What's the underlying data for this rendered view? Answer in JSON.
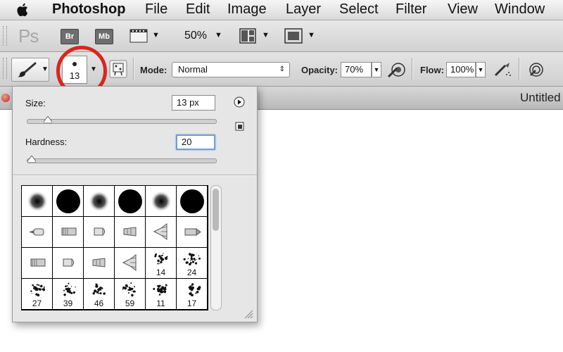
{
  "menubar": {
    "app_name": "Photoshop",
    "items": [
      "File",
      "Edit",
      "Image",
      "Layer",
      "Select",
      "Filter",
      "View",
      "Window"
    ]
  },
  "appbar": {
    "ps_logo": "Ps",
    "bridge_label": "Br",
    "minibridge_label": "Mb",
    "zoom_label": "50%"
  },
  "options": {
    "brush_size_value": "13",
    "mode_label": "Mode:",
    "mode_value": "Normal",
    "opacity_label": "Opacity:",
    "opacity_value": "70%",
    "flow_label": "Flow:",
    "flow_value": "100%"
  },
  "document": {
    "title": "Untitled"
  },
  "brush_panel": {
    "size_label": "Size:",
    "size_value": "13 px",
    "size_fraction": 0.09,
    "hardness_label": "Hardness:",
    "hardness_value": "20",
    "hardness_fraction": 0.0,
    "presets": [
      {
        "kind": "soft",
        "label": ""
      },
      {
        "kind": "hard",
        "label": ""
      },
      {
        "kind": "soft",
        "label": ""
      },
      {
        "kind": "hard",
        "label": ""
      },
      {
        "kind": "soft",
        "label": ""
      },
      {
        "kind": "hard",
        "label": ""
      },
      {
        "kind": "tip-round",
        "label": ""
      },
      {
        "kind": "tip-flat",
        "label": ""
      },
      {
        "kind": "tip-blunt",
        "label": ""
      },
      {
        "kind": "tip-angled",
        "label": ""
      },
      {
        "kind": "tip-fan",
        "label": ""
      },
      {
        "kind": "tip-point",
        "label": ""
      },
      {
        "kind": "tip-flat",
        "label": ""
      },
      {
        "kind": "tip-blunt",
        "label": ""
      },
      {
        "kind": "tip-angled",
        "label": ""
      },
      {
        "kind": "tip-fan",
        "label": ""
      },
      {
        "kind": "scatter",
        "label": "14"
      },
      {
        "kind": "scatter",
        "label": "24"
      },
      {
        "kind": "scatter",
        "label": "27"
      },
      {
        "kind": "scatter",
        "label": "39"
      },
      {
        "kind": "scatter",
        "label": "46"
      },
      {
        "kind": "scatter",
        "label": "59"
      },
      {
        "kind": "scatter",
        "label": "11"
      },
      {
        "kind": "scatter",
        "label": "17"
      }
    ]
  }
}
